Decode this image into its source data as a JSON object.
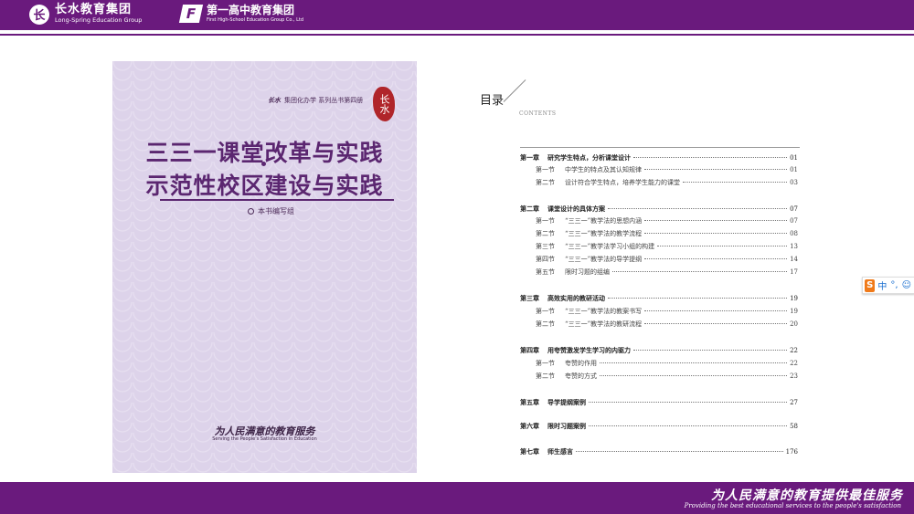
{
  "header": {
    "logo1": {
      "mark": "长",
      "cn": "长水教育集团",
      "en": "Long-Spring Education Group"
    },
    "logo2": {
      "mark": "F",
      "cn": "第一高中教育集团",
      "en": "First High-School Education Group Co., Ltd"
    }
  },
  "cover": {
    "series_brand": "长水",
    "series_rest": "集团化办学 系列丛书第四册",
    "seal": "长水",
    "title_line1": "三三一课堂改革与实践",
    "title_line2": "示范性校区建设与实践",
    "editor": "本书编写组",
    "slogan": "为人民满意的教育服务",
    "slogan_en": "Serving the People's Satisfaction in Education"
  },
  "toc": {
    "title": "目录",
    "subtitle": "CONTENTS",
    "entries": [
      {
        "num": "第一章",
        "title": "研究学生特点，分析课堂设计",
        "page": "01",
        "level": "chapter"
      },
      {
        "num": "第一节",
        "title": "中学生的特点及其认知规律",
        "page": "01",
        "level": "section"
      },
      {
        "num": "第二节",
        "title": "设计符合学生特点，培养学生能力的课堂",
        "page": "03",
        "level": "section"
      },
      {
        "num": "第二章",
        "title": "课堂设计的具体方案",
        "page": "07",
        "level": "chapter"
      },
      {
        "num": "第一节",
        "title": "“三三一”教学法的思想内涵",
        "page": "07",
        "level": "section"
      },
      {
        "num": "第二节",
        "title": "“三三一”教学法的教学流程",
        "page": "08",
        "level": "section"
      },
      {
        "num": "第三节",
        "title": "“三三一”教学法学习小组的构建",
        "page": "13",
        "level": "section"
      },
      {
        "num": "第四节",
        "title": "“三三一”教学法的导学提纲",
        "page": "14",
        "level": "section"
      },
      {
        "num": "第五节",
        "title": "限时习题的组编",
        "page": "17",
        "level": "section"
      },
      {
        "num": "第三章",
        "title": "高效实用的教研活动",
        "page": "19",
        "level": "chapter"
      },
      {
        "num": "第一节",
        "title": "“三三一”教学法的教案书写",
        "page": "19",
        "level": "section"
      },
      {
        "num": "第二节",
        "title": "“三三一”教学法的教研流程",
        "page": "20",
        "level": "section"
      },
      {
        "num": "第四章",
        "title": "用夸赞激发学生学习的内驱力",
        "page": "22",
        "level": "chapter"
      },
      {
        "num": "第一节",
        "title": "夸赞的作用",
        "page": "22",
        "level": "section"
      },
      {
        "num": "第二节",
        "title": "夸赞的方式",
        "page": "23",
        "level": "section"
      },
      {
        "num": "第五章",
        "title": "导学提纲案例",
        "page": "27",
        "level": "chapter"
      },
      {
        "num": "第六章",
        "title": "限时习题案例",
        "page": "58",
        "level": "chapter"
      },
      {
        "num": "第七章",
        "title": "师生感言",
        "page": "176",
        "level": "chapter"
      }
    ]
  },
  "ime": {
    "logo": "S",
    "lang": "中",
    "punct": "°,",
    "extra": "☺"
  },
  "footer": {
    "slogan_cn": "为人民满意的教育提供最佳服务",
    "slogan_en": "Providing the best educational services to the people's satisfaction"
  }
}
